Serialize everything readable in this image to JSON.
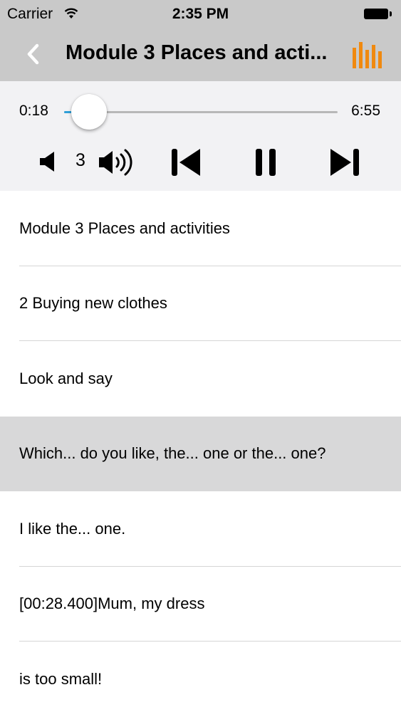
{
  "status_bar": {
    "carrier": "Carrier",
    "time": "2:35 PM"
  },
  "nav": {
    "title": "Module 3 Places and acti...",
    "back_icon": "chevron-left-icon",
    "menu_icon": "bars-chart-icon",
    "accent": "#f0890f"
  },
  "player": {
    "elapsed": "0:18",
    "duration": "6:55",
    "progress": 0.043,
    "volume_level": "3",
    "accent": "#2e9fd8"
  },
  "lyrics": [
    {
      "text": "Module 3   Places and activities",
      "active": false
    },
    {
      "text": "2   Buying new clothes",
      "active": false
    },
    {
      "text": "Look and say",
      "active": false
    },
    {
      "text": "Which... do you like, the... one or the... one?",
      "active": true
    },
    {
      "text": "I like the... one.",
      "active": false
    },
    {
      "text": "[00:28.400]Mum, my dress",
      "active": false
    },
    {
      "text": "is too small!",
      "active": false
    }
  ]
}
